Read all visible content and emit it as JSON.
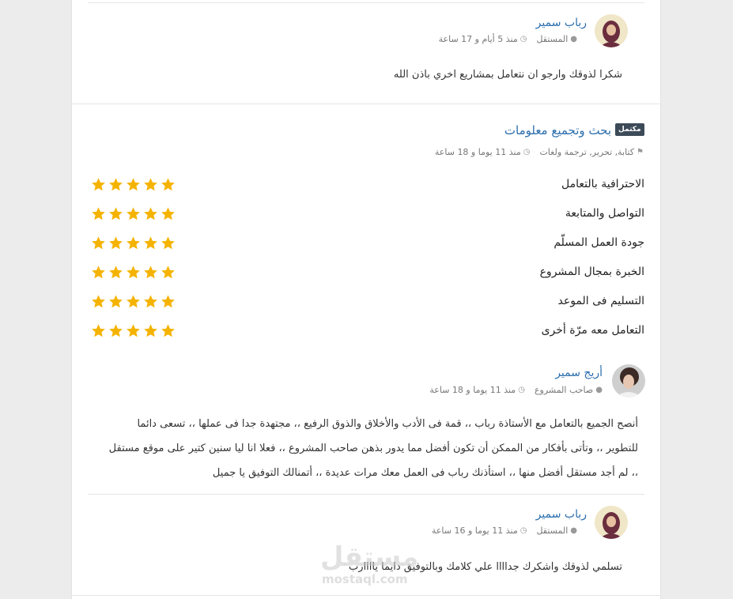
{
  "reply1": {
    "name": "رباب سمير",
    "role": "المستقل",
    "time": "منذ 5 أيام و 17 ساعة",
    "text": "شكرا لذوقك وارجو ان نتعامل بمشاريع اخري باذن الله"
  },
  "project": {
    "badge": "مكتمل",
    "title": "بحث وتجميع معلومات",
    "tags": "كتابة, تحرير, ترجمة ولغات",
    "time": "منذ 11 يوما و 18 ساعة"
  },
  "ratings": [
    {
      "label": "الاحترافية بالتعامل",
      "stars": 5
    },
    {
      "label": "التواصل والمتابعة",
      "stars": 5
    },
    {
      "label": "جودة العمل المسلّم",
      "stars": 5
    },
    {
      "label": "الخبرة بمجال المشروع",
      "stars": 5
    },
    {
      "label": "التسليم فى الموعد",
      "stars": 5
    },
    {
      "label": "التعامل معه مرّة أخرى",
      "stars": 5
    }
  ],
  "review": {
    "name": "أريج سمير",
    "role": "صاحب المشروع",
    "time": "منذ 11 يوما و 18 ساعة",
    "line1": "أنصح الجميع بالتعامل مع الأستاذة رباب ،، قمة فى الأدب والأخلاق والذوق الرفيع ،، مجتهدة جدا فى عملها ،، تسعى دائما",
    "line2": "للتطوير ،، وتأتى بأفكار من الممكن أن تكون أفضل مما يدور بذهن صاحب المشروع ،، فعلا انا ليا سنين كتير على موقع مستقل",
    "line3": "،، لم أجد مستقل أفضل منها ،، استأذنك رباب فى العمل معك مرات عديدة ،، أتمنالك التوفيق يا جميل"
  },
  "reply2": {
    "name": "رباب سمير",
    "role": "المستقل",
    "time": "منذ 11 يوما و 16 ساعة",
    "text": "تسلمي لذوقك واشكرك جداااا علي كلامك وبالتوفيق دايما ياااارب"
  },
  "watermark": {
    "logo": "مستقل",
    "domain": "mostaql.com"
  },
  "colors": {
    "star": "#f5b301",
    "link": "#2a6ead",
    "badge_bg": "#3d4a58"
  }
}
